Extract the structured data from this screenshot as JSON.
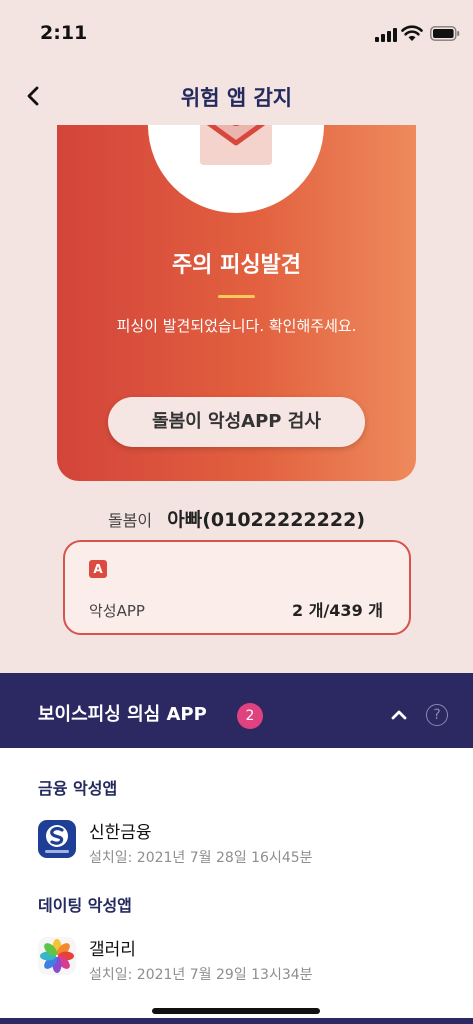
{
  "status_bar": {
    "time": "2:11"
  },
  "nav": {
    "title": "위험 앱 감지"
  },
  "alert": {
    "title": "주의 피싱발견",
    "description": "피싱이 발견되었습니다. 확인해주세요.",
    "scan_button": "돌봄이 악성APP 검사"
  },
  "child": {
    "label": "돌봄이",
    "value": "아빠(01022222222)"
  },
  "malicious_app": {
    "badge": "A",
    "label": "악성APP",
    "count": "2 개/439 개"
  },
  "voice_phishing": {
    "title": "보이스피싱 의심 APP",
    "count": "2",
    "help": "?"
  },
  "sections": [
    {
      "title": "금융 악성앱",
      "items": [
        {
          "name": "신한금융",
          "date": "설치일: 2021년 7월 28일 16시45분",
          "icon": "shinhan-icon"
        }
      ]
    },
    {
      "title": "데이팅 악성앱",
      "items": [
        {
          "name": "갤러리",
          "date": "설치일: 2021년 7월 29일 13시34분",
          "icon": "gallery-icon"
        }
      ]
    }
  ],
  "colors": {
    "background": "#f3e4e2",
    "navy": "#2c2862",
    "alert_start": "#d3443a",
    "alert_end": "#ee8a5c",
    "badge_pink": "#e0427f"
  }
}
